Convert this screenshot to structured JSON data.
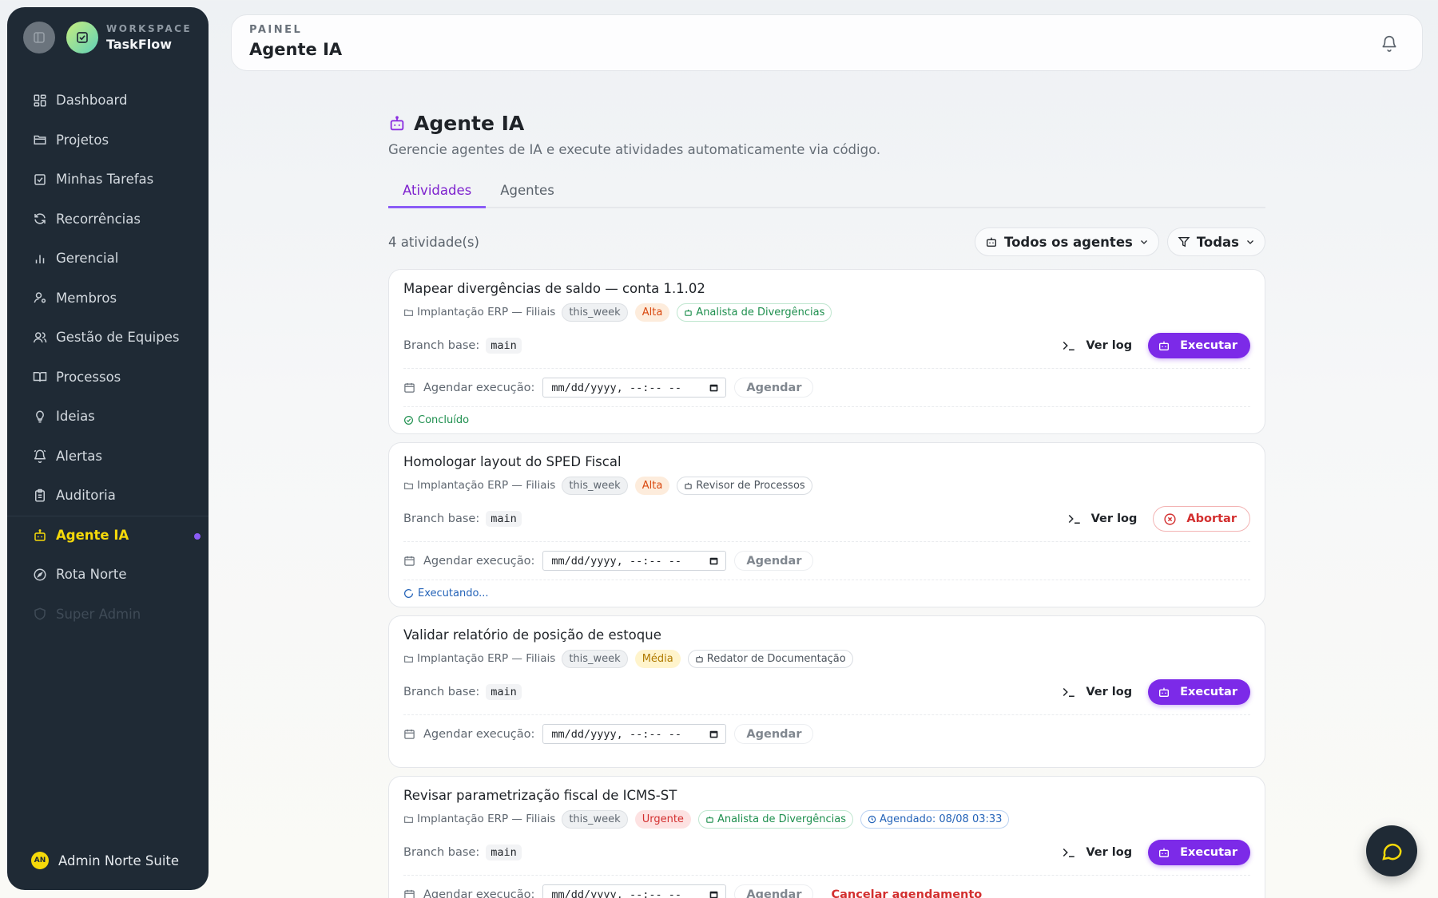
{
  "workspace": {
    "label": "WORKSPACE",
    "name": "TaskFlow"
  },
  "sidebar": {
    "items": [
      {
        "label": "Dashboard",
        "icon": "dashboard-icon"
      },
      {
        "label": "Projetos",
        "icon": "folder-icon"
      },
      {
        "label": "Minhas Tarefas",
        "icon": "checkbox-icon"
      },
      {
        "label": "Recorrências",
        "icon": "refresh-icon"
      },
      {
        "label": "Gerencial",
        "icon": "bar-chart-icon"
      },
      {
        "label": "Membros",
        "icon": "user-icon"
      },
      {
        "label": "Gestão de Equipes",
        "icon": "users-icon"
      },
      {
        "label": "Processos",
        "icon": "book-icon"
      },
      {
        "label": "Ideias",
        "icon": "lightbulb-icon"
      },
      {
        "label": "Alertas",
        "icon": "bell-icon"
      },
      {
        "label": "Auditoria",
        "icon": "clipboard-icon"
      },
      {
        "label": "Agente IA",
        "icon": "bot-icon",
        "active": true
      },
      {
        "label": "Rota Norte",
        "icon": "compass-icon"
      },
      {
        "label": "Super Admin",
        "icon": "shield-icon",
        "disabled": true
      }
    ],
    "user": {
      "initials": "AN",
      "name": "Admin Norte Suite"
    }
  },
  "header": {
    "eyebrow": "PAINEL",
    "title": "Agente IA"
  },
  "page": {
    "title": "Agente IA",
    "subtitle": "Gerencie agentes de IA e execute atividades automaticamente via código.",
    "tabs": [
      "Atividades",
      "Agentes"
    ],
    "count": "4 atividade(s)",
    "filter_agents": "Todos os agentes",
    "filter_status": "Todas"
  },
  "labels": {
    "branch": "Branch base:",
    "schedule": "Agendar execução:",
    "datetime_placeholder": "mm/dd/yyyy, --:-- --",
    "schedule_btn": "Agendar",
    "log_btn": "Ver log",
    "exec_btn": "Executar",
    "abort_btn": "Abortar",
    "cancel_schedule": "Cancelar agendamento"
  },
  "activities": [
    {
      "title": "Mapear divergências de saldo — conta 1.1.02",
      "project": "Implantação ERP — Filiais",
      "week": "this_week",
      "priority": "Alta",
      "agent": "Analista de Divergências",
      "branch": "main",
      "status": "Concluído"
    },
    {
      "title": "Homologar layout do SPED Fiscal",
      "project": "Implantação ERP — Filiais",
      "week": "this_week",
      "priority": "Alta",
      "agent": "Revisor de Processos",
      "branch": "main",
      "status": "Executando..."
    },
    {
      "title": "Validar relatório de posição de estoque",
      "project": "Implantação ERP — Filiais",
      "week": "this_week",
      "priority": "Média",
      "agent": "Redator de Documentação",
      "branch": "main"
    },
    {
      "title": "Revisar parametrização fiscal de ICMS-ST",
      "project": "Implantação ERP — Filiais",
      "week": "this_week",
      "priority": "Urgente",
      "agent": "Analista de Divergências",
      "scheduled": "Agendado: 08/08 03:33",
      "branch": "main"
    }
  ],
  "colors": {
    "accent": "#7c2ae8",
    "sidebar": "#1f2a35",
    "active_nav": "#f5d90a"
  }
}
